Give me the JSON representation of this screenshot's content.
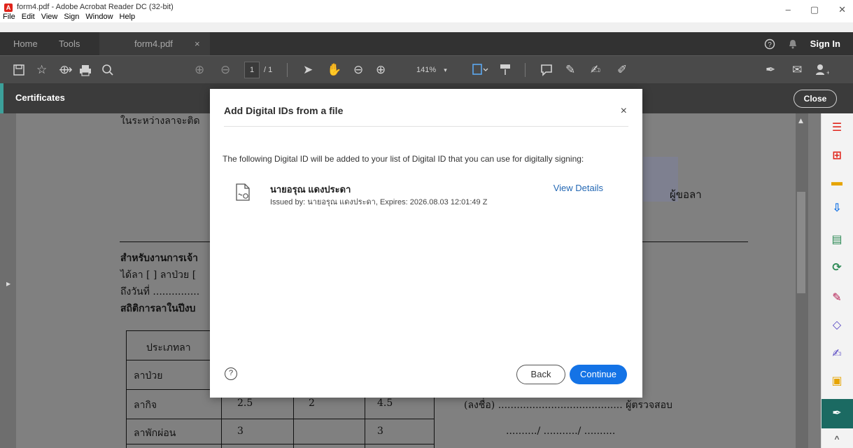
{
  "window": {
    "title": "form4.pdf - Adobe Acrobat Reader DC (32-bit)",
    "app_icon": "acrobat-icon",
    "menu": [
      "File",
      "Edit",
      "View",
      "Sign",
      "Window",
      "Help"
    ],
    "controls": {
      "minimize": "–",
      "restore": "▢",
      "close": "✕"
    }
  },
  "tabs": {
    "home": "Home",
    "tools": "Tools",
    "document": "form4.pdf",
    "close_glyph": "×",
    "sign_in": "Sign In"
  },
  "toolbar": {
    "page_current": "1",
    "page_total": "/ 1",
    "zoom": "141%"
  },
  "certificates_bar": {
    "title": "Certificates",
    "close": "Close"
  },
  "document": {
    "lines": [
      "ในระหว่างลาจะติด",
      "ผู้ขอลา",
      "สำหรับงานการเจ้า",
      "ได้ลา [ ] ลาป่วย [",
      "ถึงวันที่ ...............",
      "สถิติการลาในปีงบ",
      "(ลงชื่อ) ........................................ ผู้ตรวจสอบ",
      "........../ .........../ .........."
    ],
    "table": {
      "header": "ประเภทลา",
      "rows": [
        {
          "type": "ลาป่วย",
          "c1": "",
          "c2": "",
          "c3": ""
        },
        {
          "type": "ลากิจ",
          "c1": "2.5",
          "c2": "2",
          "c3": "4.5"
        },
        {
          "type": "ลาพักผ่อน",
          "c1": "3",
          "c2": "",
          "c3": "3"
        }
      ]
    }
  },
  "dialog": {
    "title": "Add Digital IDs from a file",
    "close_glyph": "×",
    "description": "The following Digital ID will be added to your list of Digital ID that you can use for digitally signing:",
    "id_name": "นายอรุณ แดงประดา",
    "id_issued": "Issued by: นายอรุณ แดงประดา, Expires: 2026.08.03 12:01:49 Z",
    "view_details": "View Details",
    "help_glyph": "?",
    "back": "Back",
    "continue": "Continue"
  },
  "colors": {
    "accent_blue": "#1473e6",
    "link_blue": "#2468b4",
    "teal_accent": "#3ca09a",
    "active_tool": "#1b6a62"
  }
}
